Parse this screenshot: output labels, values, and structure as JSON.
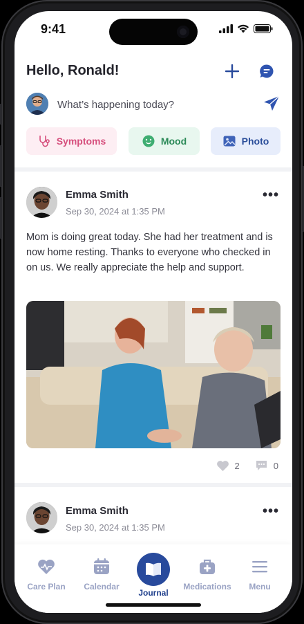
{
  "status_bar": {
    "time": "9:41"
  },
  "header": {
    "greeting": "Hello, Ronald!"
  },
  "composer": {
    "prompt": "What’s happening today?"
  },
  "quick_actions": [
    {
      "label": "Symptoms",
      "color": "#d64f7d"
    },
    {
      "label": "Mood",
      "color": "#2b8a58"
    },
    {
      "label": "Photo",
      "color": "#2b4e9a"
    }
  ],
  "posts": [
    {
      "author": "Emma Smith",
      "timestamp": "Sep 30, 2024 at 1:35 PM",
      "text": "Mom is doing great today. She had her treatment and is now home resting. Thanks to everyone who checked in on us. We really appreciate the help and support.",
      "likes": "2",
      "comments": "0"
    },
    {
      "author": "Emma Smith",
      "timestamp": "Sep 30, 2024 at 1:35 PM"
    }
  ],
  "tabs": [
    {
      "label": "Care Plan",
      "icon": "heart-pulse-icon"
    },
    {
      "label": "Calendar",
      "icon": "calendar-icon"
    },
    {
      "label": "Journal",
      "icon": "book-icon",
      "active": true
    },
    {
      "label": "Medications",
      "icon": "medical-kit-icon"
    },
    {
      "label": "Menu",
      "icon": "hamburger-icon"
    }
  ],
  "colors": {
    "brand": "#284a9c",
    "inactive": "#9aa3c4"
  }
}
